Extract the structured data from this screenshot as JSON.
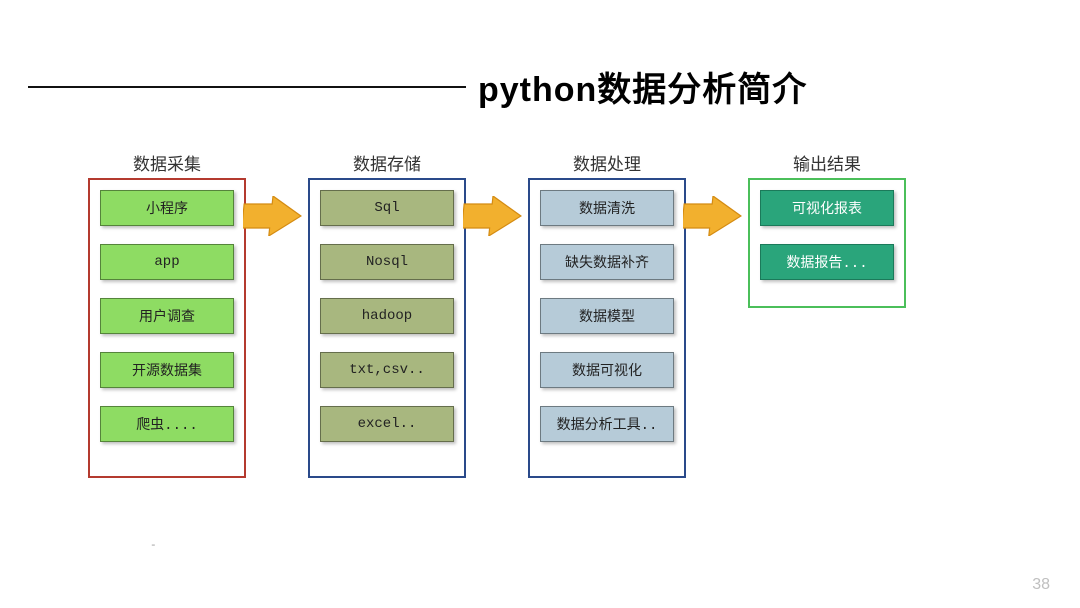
{
  "title": "python数据分析简介",
  "page_number": "38",
  "columns": [
    {
      "label": "数据采集",
      "border": "red",
      "cell_style": "c-green",
      "items": [
        "小程序",
        "app",
        "用户调查",
        "开源数据集",
        "爬虫...."
      ]
    },
    {
      "label": "数据存储",
      "border": "blue",
      "cell_style": "c-olive",
      "items": [
        "Sql",
        "Nosql",
        "hadoop",
        "txt,csv..",
        "excel.."
      ]
    },
    {
      "label": "数据处理",
      "border": "blue",
      "cell_style": "c-blue",
      "items": [
        "数据清洗",
        "缺失数据补齐",
        "数据模型",
        "数据可视化",
        "数据分析工具.."
      ]
    },
    {
      "label": "输出结果",
      "border": "green",
      "cell_style": "c-teal",
      "items": [
        "可视化报表",
        "数据报告..."
      ]
    }
  ],
  "arrow_color_fill": "#f2b02e",
  "arrow_color_stroke": "#d48b12"
}
